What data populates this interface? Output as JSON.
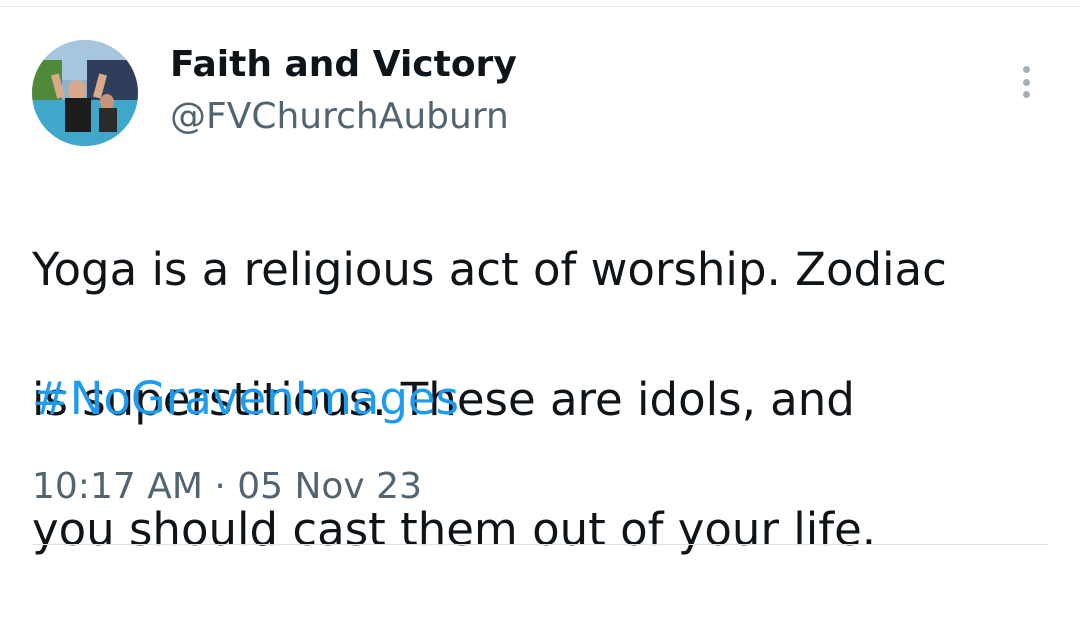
{
  "tweet": {
    "author": {
      "display_name": "Faith and Victory",
      "handle": "@FVChurchAuburn"
    },
    "text_lines": [
      "Yoga is a religious act of worship.  Zodiac",
      "is superstitious.  These are idols, and",
      "you should cast them out of your life."
    ],
    "hashtag": "#NoGravenImages",
    "timestamp": "10:17 AM · 05 Nov 23",
    "more_icon": "more-vertical-icon",
    "colors": {
      "text": "#0f1419",
      "secondary": "#536471",
      "link": "#1d9bf0"
    }
  }
}
